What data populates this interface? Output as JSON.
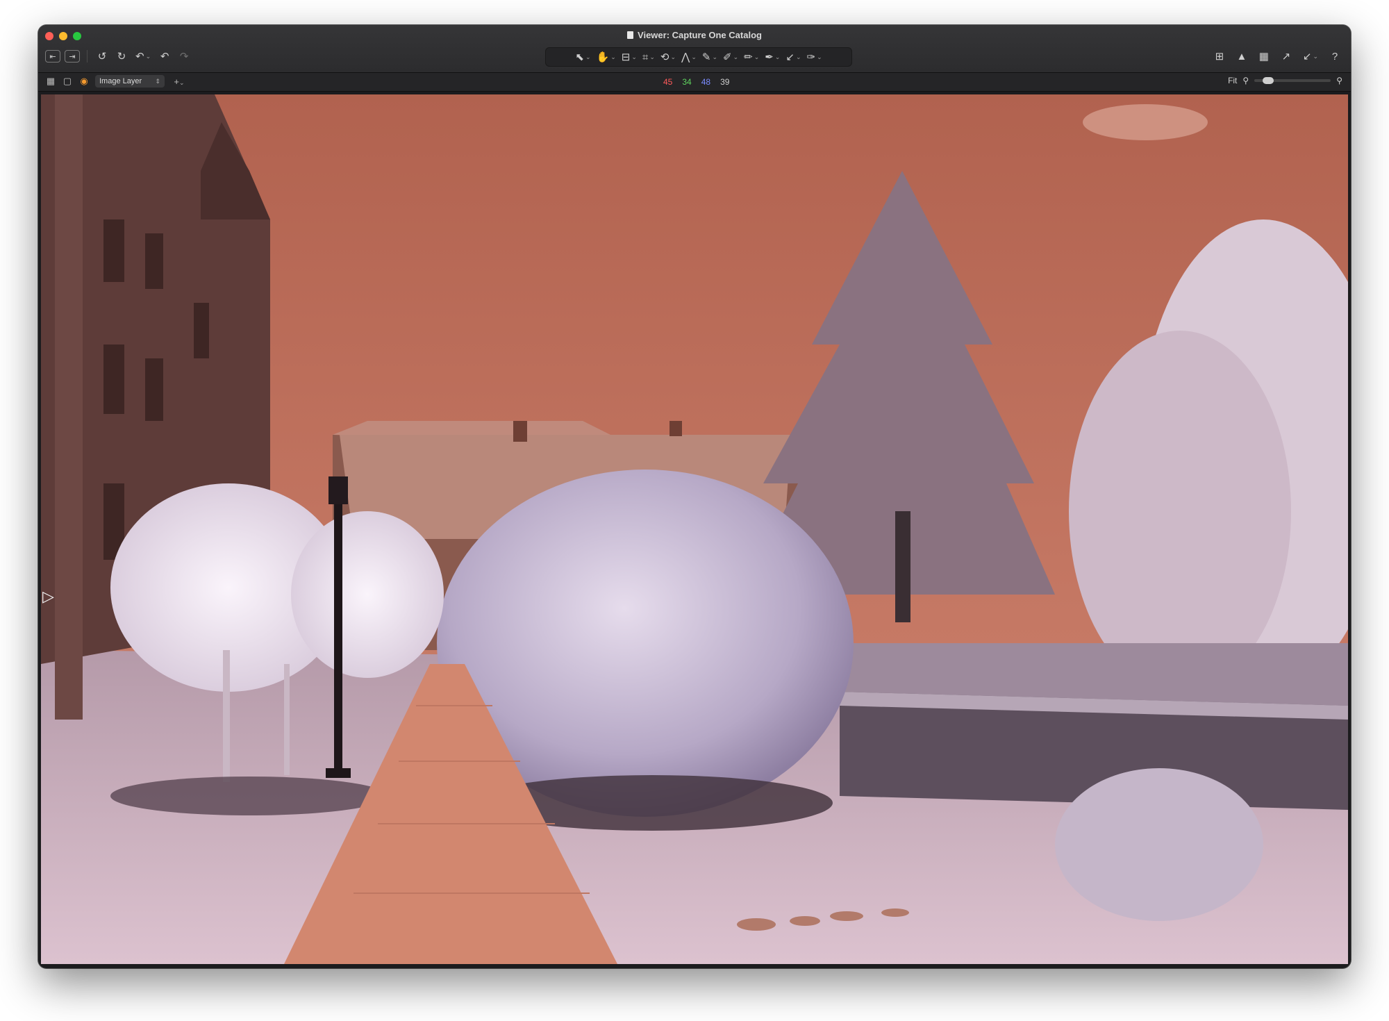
{
  "window": {
    "title": "Viewer: Capture One Catalog",
    "traffic_lights": {
      "close": "#ff5f57",
      "minimize": "#febc2e",
      "zoom": "#28c840"
    }
  },
  "toolbar": {
    "left": [
      {
        "name": "previous-image-icon",
        "glyph": "⇤"
      },
      {
        "name": "next-image-icon",
        "glyph": "⇥"
      },
      {
        "name": "rotate-left-icon",
        "glyph": "↺"
      },
      {
        "name": "rotate-right-icon",
        "glyph": "↻"
      },
      {
        "name": "reset-icon",
        "glyph": "↶"
      },
      {
        "name": "undo-icon",
        "glyph": "↶"
      },
      {
        "name": "redo-icon",
        "glyph": "↷"
      }
    ],
    "cursor_tools": [
      {
        "name": "select-tool-icon",
        "glyph": "⬉"
      },
      {
        "name": "pan-tool-icon",
        "glyph": "✋"
      },
      {
        "name": "loupe-tool-icon",
        "glyph": "⊟"
      },
      {
        "name": "crop-tool-icon",
        "glyph": "⌗"
      },
      {
        "name": "rotate-tool-icon",
        "glyph": "⟲"
      },
      {
        "name": "keystone-tool-icon",
        "glyph": "⋀"
      },
      {
        "name": "spot-removal-tool-icon",
        "glyph": "✎"
      },
      {
        "name": "draw-mask-tool-icon",
        "glyph": "✐"
      },
      {
        "name": "erase-mask-tool-icon",
        "glyph": "✏"
      },
      {
        "name": "linear-gradient-tool-icon",
        "glyph": "✒"
      },
      {
        "name": "radial-gradient-tool-icon",
        "glyph": "↙"
      },
      {
        "name": "color-picker-tool-icon",
        "glyph": "✑"
      }
    ],
    "right": [
      {
        "name": "compare-icon",
        "glyph": "⊞"
      },
      {
        "name": "exposure-warning-icon",
        "glyph": "▲"
      },
      {
        "name": "grid-icon",
        "glyph": "▦"
      },
      {
        "name": "copy-adjustments-icon",
        "glyph": "↗"
      },
      {
        "name": "apply-adjustments-icon",
        "glyph": "↙"
      },
      {
        "name": "help-icon",
        "glyph": "?"
      }
    ]
  },
  "subbar": {
    "layer_label": "Image Layer",
    "add_layer_glyph": "+",
    "readout": {
      "r": "45",
      "g": "34",
      "b": "48",
      "l": "39"
    },
    "zoom_label": "Fit"
  }
}
